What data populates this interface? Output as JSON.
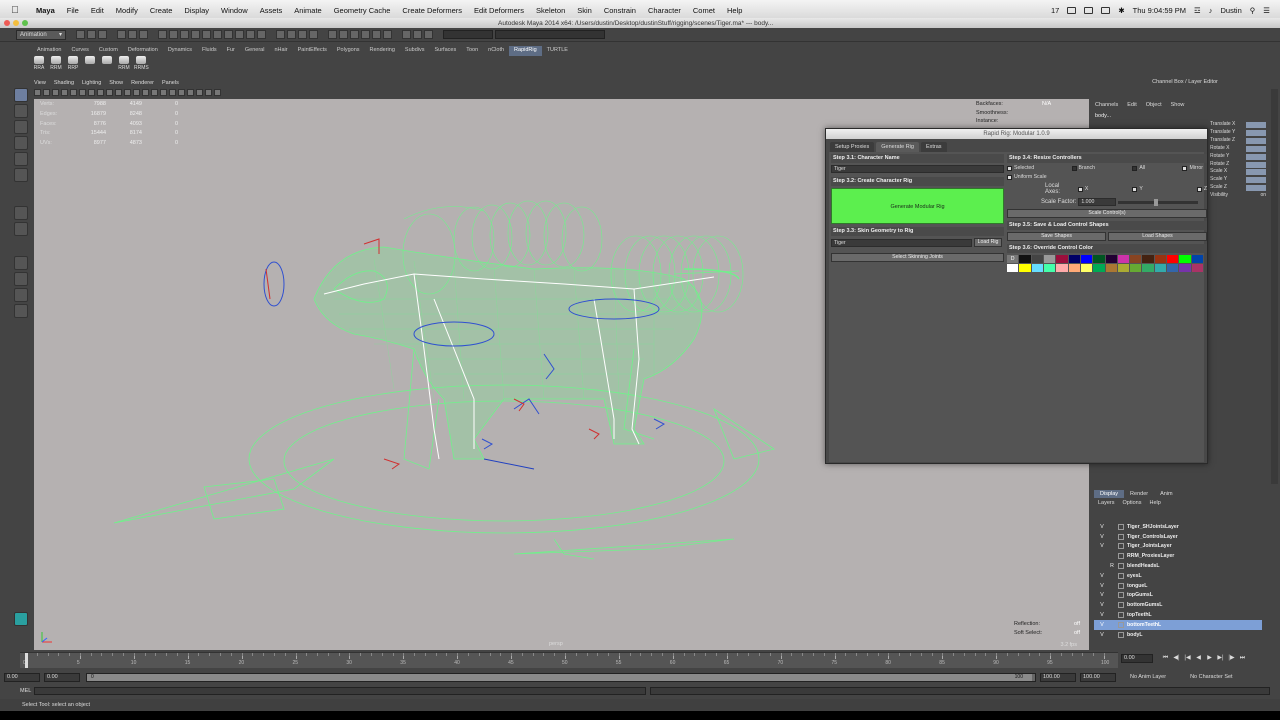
{
  "menubar": {
    "app": "Maya",
    "items": [
      "File",
      "Edit",
      "Modify",
      "Create",
      "Display",
      "Window",
      "Assets",
      "Animate",
      "Geometry Cache",
      "Create Deformers",
      "Edit Deformers",
      "Skeleton",
      "Skin",
      "Constrain",
      "Character",
      "Comet",
      "Help"
    ],
    "badge": "17",
    "clock": "Thu 9:04:59 PM",
    "user": "Dustin"
  },
  "window_title": "Autodesk Maya 2014 x64: /Users/dustin/Desktop/dustinStuff/rigging/scenes/Tiger.ma* --- body...",
  "statusline": {
    "mode": "Animation"
  },
  "shelf": {
    "tabs": [
      "Animation",
      "Curves",
      "Custom",
      "Deformation",
      "Dynamics",
      "Fluids",
      "Fur",
      "General",
      "nHair",
      "PaintEffects",
      "Polygons",
      "Rendering",
      "Subdivs",
      "Surfaces",
      "Toon",
      "nCloth",
      "RapidRig",
      "TURTLE"
    ],
    "active_tab": "RapidRig",
    "icons": [
      "RRA",
      "RRM",
      "RRP",
      "",
      "",
      "RRM",
      "RRMS"
    ]
  },
  "panel_menu": [
    "View",
    "Shading",
    "Lighting",
    "Show",
    "Renderer",
    "Panels"
  ],
  "hud_left": [
    {
      "k": "Verts:",
      "a": "7988",
      "b": "4149",
      "c": "0"
    },
    {
      "k": "Edges:",
      "a": "16879",
      "b": "8248",
      "c": "0"
    },
    {
      "k": "Faces:",
      "a": "8776",
      "b": "4093",
      "c": "0"
    },
    {
      "k": "Tris:",
      "a": "15444",
      "b": "8174",
      "c": "0"
    },
    {
      "k": "UVs:",
      "a": "8977",
      "b": "4873",
      "c": "0"
    }
  ],
  "hud_right": [
    {
      "k": "Backfaces:",
      "v": "N/A"
    },
    {
      "k": "Smoothness:",
      "v": ""
    },
    {
      "k": "Instance:",
      "v": ""
    }
  ],
  "hud_bottom_right": [
    {
      "k": "Reflection:",
      "v": "off"
    },
    {
      "k": "Soft Select:",
      "v": "off"
    }
  ],
  "camera": "persp",
  "fps": "3.2 fps",
  "channel_box": {
    "title": "Channel Box / Layer Editor",
    "menu": [
      "Channels",
      "Edit",
      "Object",
      "Show"
    ],
    "object": "body...",
    "channels": [
      "Translate X",
      "Translate Y",
      "Translate Z",
      "Rotate X",
      "Rotate Y",
      "Rotate Z",
      "Scale X",
      "Scale Y",
      "Scale Z",
      "Visibility"
    ],
    "visibility_value": "on"
  },
  "layer_editor": {
    "tabs": [
      "Display",
      "Render",
      "Anim"
    ],
    "active_tab": "Display",
    "menu": [
      "Layers",
      "Options",
      "Help"
    ],
    "layers": [
      {
        "v": "V",
        "r": "",
        "name": "Tiger_SHJointsLayer",
        "sel": false
      },
      {
        "v": "V",
        "r": "",
        "name": "Tiger_ControlsLayer",
        "sel": false
      },
      {
        "v": "V",
        "r": "",
        "name": "Tiger_JointsLayer",
        "sel": false
      },
      {
        "v": "",
        "r": "",
        "name": "RRM_ProxiesLayer",
        "sel": false
      },
      {
        "v": "",
        "r": "R",
        "name": "blendHeadsL",
        "sel": false
      },
      {
        "v": "V",
        "r": "",
        "name": "eyesL",
        "sel": false
      },
      {
        "v": "V",
        "r": "",
        "name": "tongueL",
        "sel": false
      },
      {
        "v": "V",
        "r": "",
        "name": "topGumsL",
        "sel": false
      },
      {
        "v": "V",
        "r": "",
        "name": "bottomGumsL",
        "sel": false
      },
      {
        "v": "V",
        "r": "",
        "name": "topTeethL",
        "sel": false
      },
      {
        "v": "V",
        "r": "",
        "name": "bottomTeethL",
        "sel": true
      },
      {
        "v": "V",
        "r": "",
        "name": "bodyL",
        "sel": false
      }
    ]
  },
  "rapid_rig": {
    "title": "Rapid Rig: Modular 1.0.9",
    "tabs": [
      "Setup Proxies",
      "Generate Rig",
      "Extras"
    ],
    "active_tab": "Generate Rig",
    "step31": "Step 3.1: Character Name",
    "char_name": "Tiger",
    "step32": "Step 3.2: Create Character Rig",
    "generate_btn": "Generate Modular Rig",
    "step33": "Step 3.3: Skin Geometry to Rig",
    "skin_field": "Tiger",
    "load_rig": "Load Rig",
    "select_joints": "Select Skinning Joints",
    "step34": "Step 3.4: Resize Controllers",
    "opt_selected": "Selected",
    "opt_branch": "Branch",
    "opt_all": "All",
    "opt_mirror": "Mirror",
    "opt_uniform": "Uniform Scale",
    "local_axes": "Local Axes:",
    "axis_x": "X",
    "axis_y": "Y",
    "axis_z": "Z",
    "scale_factor_label": "Scale Factor:",
    "scale_factor": "1.000",
    "scale_btn": "Scale Control(s)",
    "step35": "Step 3.5: Save & Load Control Shapes",
    "save_shapes": "Save Shapes",
    "load_shapes": "Load Shapes",
    "step36": "Step 3.6: Override Control Color",
    "palette_first": "D",
    "palette": [
      "#777777",
      "#111111",
      "#444444",
      "#999999",
      "#9b0f3c",
      "#000066",
      "#0000ff",
      "#005522",
      "#220033",
      "#cc33aa",
      "#884422",
      "#442211",
      "#993311",
      "#ff0000",
      "#00ff00",
      "#0044aa",
      "#ffffff",
      "#ffff00",
      "#66ddff",
      "#44ffaa",
      "#ffaaaa",
      "#ffaa77",
      "#ffff66",
      "#00aa55",
      "#aa7733",
      "#aaaa33",
      "#66aa33",
      "#33aa66",
      "#33aaaa",
      "#3366aa",
      "#7733aa",
      "#aa3366"
    ]
  },
  "timeline": {
    "ticks": [
      "0",
      "5",
      "10",
      "15",
      "20",
      "25",
      "30",
      "35",
      "40",
      "45",
      "50",
      "55",
      "60",
      "65",
      "70",
      "75",
      "80",
      "85",
      "90",
      "95",
      "100"
    ],
    "current": "0.00",
    "range_start": "0.00",
    "range_inner_start": "0.00",
    "range_start_marker": "0",
    "range_end_marker": "100",
    "range_inner_end": "100.00",
    "range_end": "100.00",
    "anim_layer": "No Anim Layer",
    "char_set": "No Character Set"
  },
  "mel_label": "MEL",
  "help_line": "Select Tool: select an object",
  "colors": {
    "viewport": "#b5b1b1",
    "wire": "#6ff28a",
    "generate": "#5cef4e",
    "selection": "#7d9fd6"
  }
}
